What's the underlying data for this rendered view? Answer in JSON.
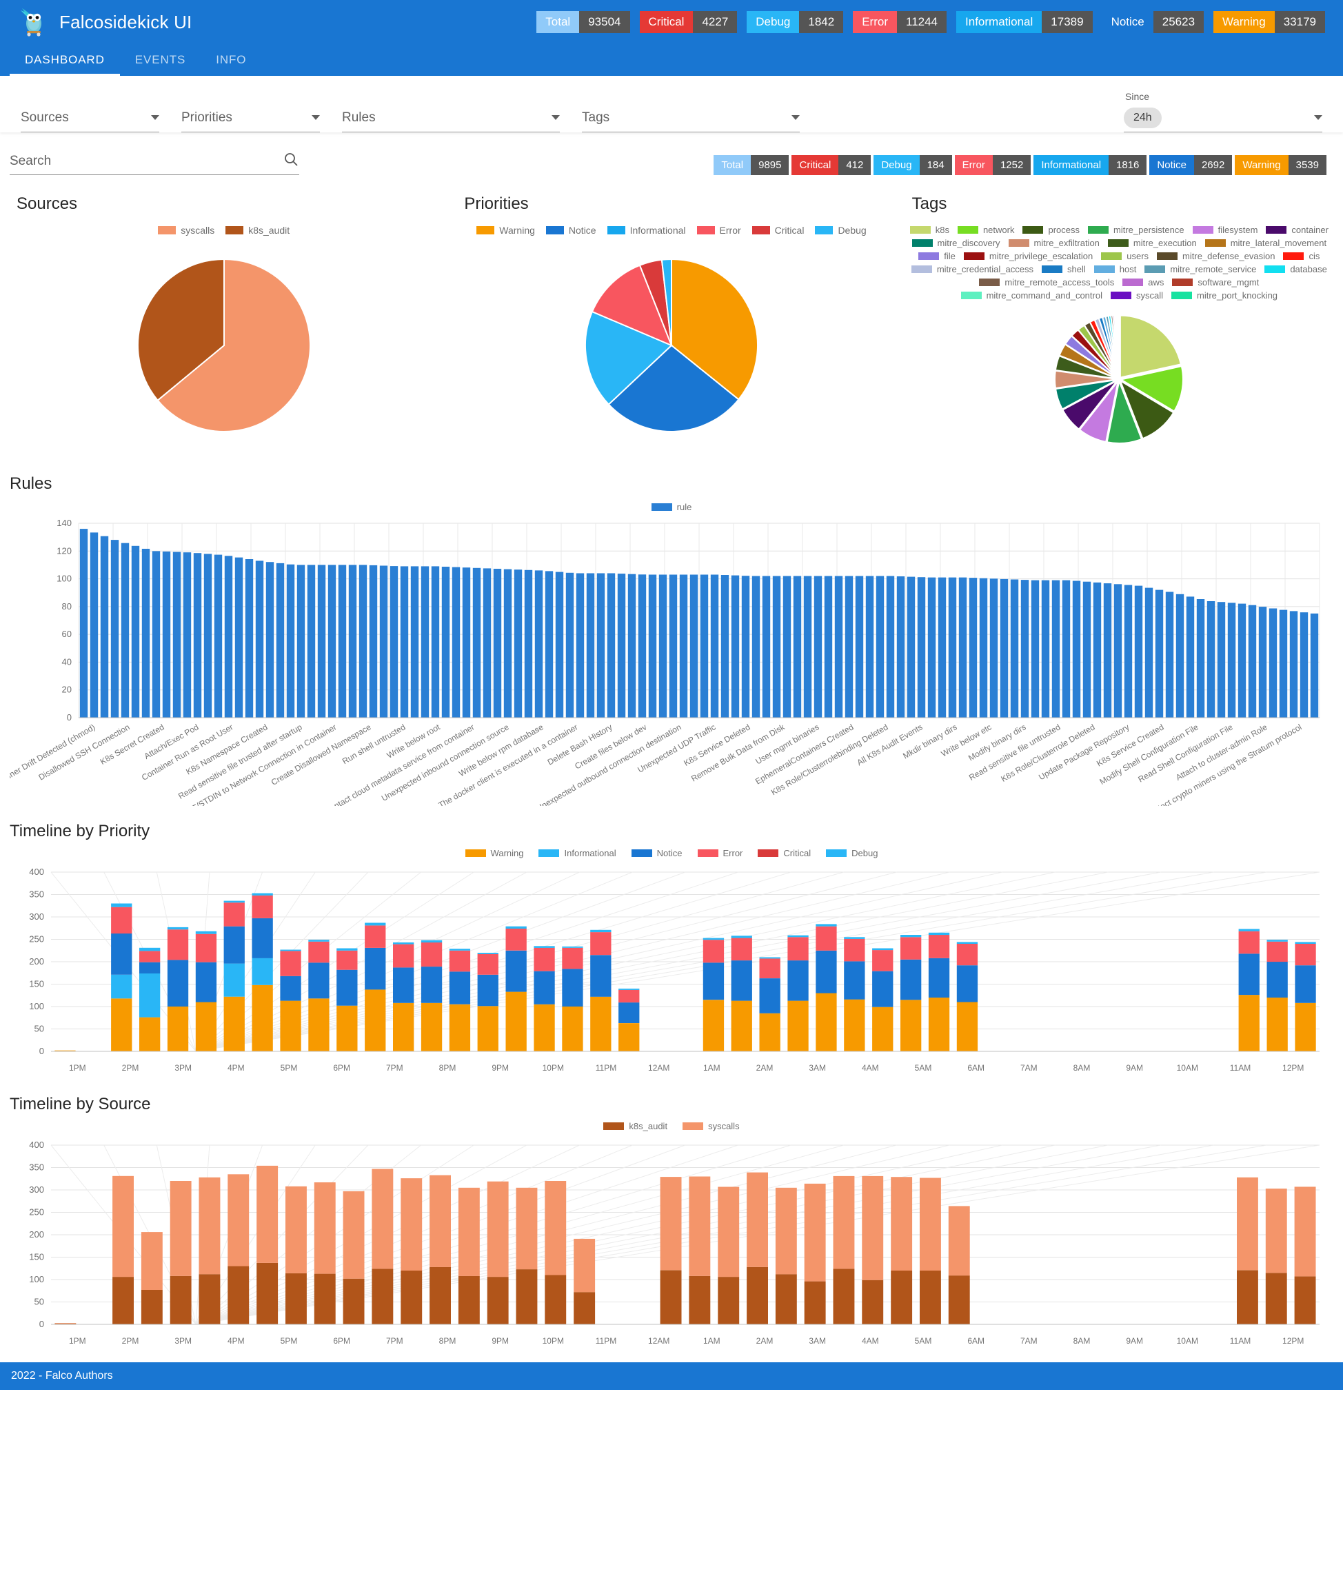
{
  "app": {
    "title": "Falcosidekick UI",
    "logo_icon": "falco-gopher-logo",
    "accent": "#1976d2",
    "footer": "2022 - Falco Authors"
  },
  "tabs": [
    {
      "label": "DASHBOARD",
      "active": true
    },
    {
      "label": "EVENTS",
      "active": false
    },
    {
      "label": "INFO",
      "active": false
    }
  ],
  "header_badges": [
    {
      "label": "Total",
      "value": "93504",
      "color": "#90caf9"
    },
    {
      "label": "Critical",
      "value": "4227",
      "color": "#e53935"
    },
    {
      "label": "Debug",
      "value": "1842",
      "color": "#29b6f6"
    },
    {
      "label": "Error",
      "value": "11244",
      "color": "#f8565f"
    },
    {
      "label": "Informational",
      "value": "17389",
      "color": "#17a7ee"
    },
    {
      "label": "Notice",
      "value": "25623",
      "color": "#1976d2"
    },
    {
      "label": "Warning",
      "value": "33179",
      "color": "#f79a00"
    }
  ],
  "sub_badges": [
    {
      "label": "Total",
      "value": "9895",
      "color": "#90caf9"
    },
    {
      "label": "Critical",
      "value": "412",
      "color": "#e53935"
    },
    {
      "label": "Debug",
      "value": "184",
      "color": "#29b6f6"
    },
    {
      "label": "Error",
      "value": "1252",
      "color": "#f8565f"
    },
    {
      "label": "Informational",
      "value": "1816",
      "color": "#17a7ee"
    },
    {
      "label": "Notice",
      "value": "2692",
      "color": "#1976d2"
    },
    {
      "label": "Warning",
      "value": "3539",
      "color": "#f79a00"
    }
  ],
  "filters": {
    "sources": "Sources",
    "priorities": "Priorities",
    "rules": "Rules",
    "tags": "Tags",
    "since_caption": "Since",
    "since_value": "24h"
  },
  "search": {
    "placeholder": "Search",
    "value": "",
    "icon": "search-icon"
  },
  "sections": {
    "sources": "Sources",
    "priorities": "Priorities",
    "tags": "Tags",
    "rules": "Rules",
    "timeline_priority": "Timeline by Priority",
    "timeline_source": "Timeline by Source"
  },
  "chart_data": [
    {
      "type": "pie",
      "title": "Sources",
      "legend_position": "top",
      "labels": [
        "syscalls",
        "k8s_audit"
      ],
      "values": [
        64,
        36
      ],
      "colors": [
        "#f4956a",
        "#b1551a"
      ]
    },
    {
      "type": "pie",
      "title": "Priorities",
      "legend_position": "top",
      "labels": [
        "Warning",
        "Notice",
        "Informational",
        "Error",
        "Critical",
        "Debug"
      ],
      "values": [
        35.8,
        27.2,
        18.4,
        12.6,
        4.2,
        1.8
      ],
      "colors": [
        "#f79a00",
        "#1976d2",
        "#29b6f6",
        "#f8565f",
        "#d93a3a",
        "#29b6f6"
      ]
    },
    {
      "type": "pie",
      "title": "Tags",
      "legend_position": "top",
      "labels": [
        "k8s",
        "network",
        "process",
        "mitre_persistence",
        "filesystem",
        "container",
        "mitre_discovery",
        "mitre_exfiltration",
        "mitre_execution",
        "mitre_lateral_movement",
        "file",
        "mitre_privilege_escalation",
        "users",
        "mitre_defense_evasion",
        "cis",
        "mitre_credential_access",
        "shell",
        "host",
        "mitre_remote_service",
        "database",
        "mitre_remote_access_tools",
        "aws",
        "software_mgmt",
        "mitre_command_and_control",
        "syscall",
        "mitre_port_knocking"
      ],
      "values": [
        21.5,
        12.0,
        10.5,
        9.0,
        7.5,
        6.5,
        5.5,
        4.5,
        3.8,
        3.2,
        2.6,
        2.2,
        1.9,
        1.6,
        1.3,
        1.1,
        0.95,
        0.8,
        0.7,
        0.6,
        0.5,
        0.42,
        0.35,
        0.3,
        0.25,
        0.2
      ],
      "colors": [
        "#c5d86d",
        "#77dd22",
        "#3c5a14",
        "#2eab4f",
        "#c47ae0",
        "#4a0a6b",
        "#00806b",
        "#d08c6e",
        "#3d5c1b",
        "#b5751a",
        "#8d7ae0",
        "#9b1010",
        "#9dc64b",
        "#5a4a2a",
        "#ff1a0d",
        "#b3bede",
        "#1a7bc4",
        "#62aee0",
        "#5b9cb3",
        "#12dff0",
        "#7a5c48",
        "#bb6ad0",
        "#b03c2a",
        "#5ef0c0",
        "#6a0ec2",
        "#17e2a0"
      ]
    },
    {
      "type": "bar",
      "title": "Rules",
      "legend": [
        "rule"
      ],
      "legend_color": "#2a7fd4",
      "ylabel": "",
      "xlabel": "",
      "ylim": [
        0,
        140
      ],
      "yticks": [
        0,
        20,
        40,
        60,
        80,
        100,
        120,
        140
      ],
      "categories": [
        "Container Drift Detected (chmod)",
        "Disallowed SSH Connection",
        "K8s Secret Created",
        "Attach/Exec Pod",
        "Container Run as Root User",
        "K8s Namespace Created",
        "Read sensitive file trusted after startup",
        "Redirect STDOUT/STDIN to Network Connection in Container",
        "Create Disallowed Namespace",
        "Run shell untrusted",
        "Write below root",
        "Contact cloud metadata service from container",
        "Unexpected inbound connection source",
        "Write below rpm database",
        "The docker client is executed in a container",
        "Delete Bash History",
        "Create files below dev",
        "Unexpected outbound connection destination",
        "Unexpected UDP Traffic",
        "K8s Service Deleted",
        "Remove Bulk Data from Disk",
        "User mgmt binaries",
        "EphemeralContainers Created",
        "K8s Role/Clusterrolebinding Deleted",
        "All K8s Audit Events",
        "Mkdir binary dirs",
        "Write below etc",
        "Modify binary dirs",
        "Read sensitive file untrusted",
        "K8s Role/Clusterrole Deleted",
        "Update Package Repository",
        "K8s Service Created",
        "Modify Shell Configuration File",
        "Read Shell Configuration File",
        "Attach to cluster-admin Role",
        "Detect crypto miners using the Stratum protocol"
      ],
      "values": [
        136,
        127,
        120,
        119,
        117,
        113,
        110,
        110,
        110,
        109,
        109,
        108,
        107,
        106,
        104,
        104,
        103,
        103,
        103,
        102,
        102,
        102,
        102,
        102,
        101,
        101,
        100,
        99,
        99,
        97,
        95,
        90,
        84,
        82,
        78,
        75
      ],
      "bar_count": 120,
      "bar_color": "#2a7fd4"
    },
    {
      "type": "bar",
      "title": "Timeline by Priority",
      "stacked": true,
      "legend_position": "top",
      "ylim": [
        0,
        400
      ],
      "yticks": [
        0,
        50,
        100,
        150,
        200,
        250,
        300,
        350,
        400
      ],
      "xticks": [
        "1PM",
        "2PM",
        "3PM",
        "4PM",
        "5PM",
        "6PM",
        "7PM",
        "8PM",
        "9PM",
        "10PM",
        "11PM",
        "12AM",
        "1AM",
        "2AM",
        "3AM",
        "4AM",
        "5AM",
        "6AM",
        "7AM",
        "8AM",
        "9AM",
        "10AM",
        "11AM",
        "12PM"
      ],
      "series": [
        {
          "name": "Warning",
          "color": "#f79a00",
          "values": [
            2,
            0,
            118,
            76,
            100,
            110,
            122,
            148,
            113,
            118,
            102,
            138,
            108,
            108,
            105,
            101,
            133,
            105,
            100,
            122,
            63,
            0,
            0,
            115,
            113,
            85,
            113,
            130,
            116,
            99,
            115,
            120,
            110,
            0,
            0,
            0,
            0,
            0,
            0,
            0,
            0,
            0,
            126,
            120,
            108
          ]
        },
        {
          "name": "Informational",
          "color": "#29b6f6",
          "values": [
            0,
            0,
            53,
            98,
            0,
            0,
            74,
            60,
            0,
            0,
            0,
            0,
            0,
            0,
            0,
            0,
            0,
            0,
            0,
            0,
            0,
            0,
            0,
            0,
            0,
            0,
            0,
            0,
            0,
            0,
            0,
            0,
            0,
            0,
            0,
            0,
            0,
            0,
            0,
            0,
            0,
            0,
            0,
            0,
            0
          ]
        },
        {
          "name": "Notice",
          "color": "#1976d2",
          "values": [
            0,
            0,
            92,
            25,
            104,
            89,
            83,
            89,
            55,
            80,
            80,
            93,
            79,
            81,
            73,
            70,
            92,
            74,
            84,
            93,
            46,
            0,
            0,
            83,
            90,
            78,
            90,
            95,
            85,
            80,
            90,
            88,
            82,
            0,
            0,
            0,
            0,
            0,
            0,
            0,
            0,
            0,
            92,
            80,
            84
          ]
        },
        {
          "name": "Error",
          "color": "#f8565f",
          "values": [
            0,
            0,
            59,
            25,
            68,
            63,
            53,
            51,
            56,
            47,
            43,
            50,
            52,
            54,
            47,
            46,
            49,
            52,
            47,
            51,
            28,
            0,
            0,
            51,
            50,
            44,
            52,
            54,
            50,
            47,
            50,
            52,
            48,
            0,
            0,
            0,
            0,
            0,
            0,
            0,
            0,
            0,
            50,
            45,
            48
          ]
        },
        {
          "name": "Critical",
          "color": "#d93a3a",
          "values": [
            0,
            0,
            0,
            0,
            0,
            0,
            0,
            0,
            0,
            0,
            0,
            0,
            0,
            0,
            0,
            0,
            0,
            0,
            0,
            0,
            0,
            0,
            0,
            0,
            0,
            0,
            0,
            0,
            0,
            0,
            0,
            0,
            0,
            0,
            0,
            0,
            0,
            0,
            0,
            0,
            0,
            0,
            0,
            0,
            0
          ]
        },
        {
          "name": "Debug",
          "color": "#29b6f6",
          "values": [
            0,
            0,
            8,
            7,
            5,
            6,
            4,
            5,
            3,
            4,
            5,
            6,
            4,
            5,
            4,
            3,
            5,
            4,
            3,
            5,
            3,
            0,
            0,
            4,
            5,
            3,
            4,
            5,
            4,
            4,
            5,
            5,
            4,
            0,
            0,
            0,
            0,
            0,
            0,
            0,
            0,
            0,
            5,
            4,
            4
          ]
        }
      ],
      "totals": [
        2,
        0,
        331,
        206,
        320,
        328,
        335,
        354,
        308,
        317,
        297,
        347,
        326,
        333,
        305,
        338,
        305,
        320,
        191,
        0,
        0,
        329,
        330,
        307,
        339,
        305,
        314,
        331,
        331,
        329,
        327,
        328,
        264,
        0,
        0,
        0,
        0,
        0,
        0,
        0,
        0,
        0,
        328,
        303,
        307
      ]
    },
    {
      "type": "bar",
      "title": "Timeline by Source",
      "stacked": true,
      "legend_position": "top",
      "ylim": [
        0,
        400
      ],
      "yticks": [
        0,
        50,
        100,
        150,
        200,
        250,
        300,
        350,
        400
      ],
      "xticks": [
        "1PM",
        "2PM",
        "3PM",
        "4PM",
        "5PM",
        "6PM",
        "7PM",
        "8PM",
        "9PM",
        "10PM",
        "11PM",
        "12AM",
        "1AM",
        "2AM",
        "3AM",
        "4AM",
        "5AM",
        "6AM",
        "7AM",
        "8AM",
        "9AM",
        "10AM",
        "11AM",
        "12PM"
      ],
      "series": [
        {
          "name": "k8s_audit",
          "color": "#b1551a",
          "values": [
            2,
            0,
            106,
            77,
            108,
            112,
            130,
            137,
            114,
            113,
            102,
            124,
            120,
            128,
            108,
            106,
            123,
            110,
            72,
            0,
            0,
            121,
            108,
            106,
            128,
            112,
            96,
            124,
            99,
            120,
            120,
            109,
            0,
            0,
            0,
            0,
            0,
            0,
            0,
            0,
            0,
            121,
            115,
            107
          ]
        },
        {
          "name": "syscalls",
          "color": "#f4956a",
          "values": [
            1,
            0,
            225,
            129,
            212,
            216,
            205,
            217,
            194,
            204,
            195,
            223,
            206,
            205,
            197,
            213,
            182,
            210,
            119,
            0,
            0,
            208,
            222,
            201,
            211,
            193,
            218,
            207,
            232,
            209,
            207,
            155,
            0,
            0,
            0,
            0,
            0,
            0,
            0,
            0,
            0,
            207,
            188,
            200
          ]
        }
      ],
      "totals": [
        3,
        0,
        331,
        206,
        320,
        328,
        335,
        354,
        308,
        317,
        297,
        347,
        326,
        333,
        305,
        319,
        305,
        320,
        191,
        0,
        0,
        329,
        330,
        307,
        339,
        305,
        314,
        331,
        331,
        329,
        327,
        264,
        0,
        0,
        0,
        0,
        0,
        0,
        0,
        0,
        0,
        328,
        303,
        307
      ]
    }
  ],
  "legends": {
    "sources": [
      {
        "label": "syscalls",
        "color": "#f4956a"
      },
      {
        "label": "k8s_audit",
        "color": "#b1551a"
      }
    ],
    "priorities": [
      {
        "label": "Warning",
        "color": "#f79a00"
      },
      {
        "label": "Notice",
        "color": "#1976d2"
      },
      {
        "label": "Informational",
        "color": "#17a7ee"
      },
      {
        "label": "Error",
        "color": "#f8565f"
      },
      {
        "label": "Critical",
        "color": "#d93a3a"
      },
      {
        "label": "Debug",
        "color": "#29b6f6"
      }
    ],
    "tags": [
      {
        "label": "k8s",
        "color": "#c5d86d"
      },
      {
        "label": "network",
        "color": "#77dd22"
      },
      {
        "label": "process",
        "color": "#3c5a14"
      },
      {
        "label": "mitre_persistence",
        "color": "#2eab4f"
      },
      {
        "label": "filesystem",
        "color": "#c47ae0"
      },
      {
        "label": "container",
        "color": "#4a0a6b"
      },
      {
        "label": "mitre_discovery",
        "color": "#00806b"
      },
      {
        "label": "mitre_exfiltration",
        "color": "#d08c6e"
      },
      {
        "label": "mitre_execution",
        "color": "#3d5c1b"
      },
      {
        "label": "mitre_lateral_movement",
        "color": "#b5751a"
      },
      {
        "label": "file",
        "color": "#8d7ae0"
      },
      {
        "label": "mitre_privilege_escalation",
        "color": "#9b1010"
      },
      {
        "label": "users",
        "color": "#9dc64b"
      },
      {
        "label": "mitre_defense_evasion",
        "color": "#5a4a2a"
      },
      {
        "label": "cis",
        "color": "#ff1a0d"
      },
      {
        "label": "mitre_credential_access",
        "color": "#b3bede"
      },
      {
        "label": "shell",
        "color": "#1a7bc4"
      },
      {
        "label": "host",
        "color": "#62aee0"
      },
      {
        "label": "mitre_remote_service",
        "color": "#5b9cb3"
      },
      {
        "label": "database",
        "color": "#12dff0"
      },
      {
        "label": "mitre_remote_access_tools",
        "color": "#7a5c48"
      },
      {
        "label": "aws",
        "color": "#bb6ad0"
      },
      {
        "label": "software_mgmt",
        "color": "#b03c2a"
      },
      {
        "label": "mitre_command_and_control",
        "color": "#5ef0c0"
      },
      {
        "label": "syscall",
        "color": "#6a0ec2"
      },
      {
        "label": "mitre_port_knocking",
        "color": "#17e2a0"
      }
    ],
    "rules": [
      {
        "label": "rule",
        "color": "#2a7fd4"
      }
    ],
    "timeline_priority": [
      {
        "label": "Warning",
        "color": "#f79a00"
      },
      {
        "label": "Informational",
        "color": "#29b6f6"
      },
      {
        "label": "Notice",
        "color": "#1976d2"
      },
      {
        "label": "Error",
        "color": "#f8565f"
      },
      {
        "label": "Critical",
        "color": "#d93a3a"
      },
      {
        "label": "Debug",
        "color": "#29b6f6"
      }
    ],
    "timeline_source": [
      {
        "label": "k8s_audit",
        "color": "#b1551a"
      },
      {
        "label": "syscalls",
        "color": "#f4956a"
      }
    ]
  }
}
